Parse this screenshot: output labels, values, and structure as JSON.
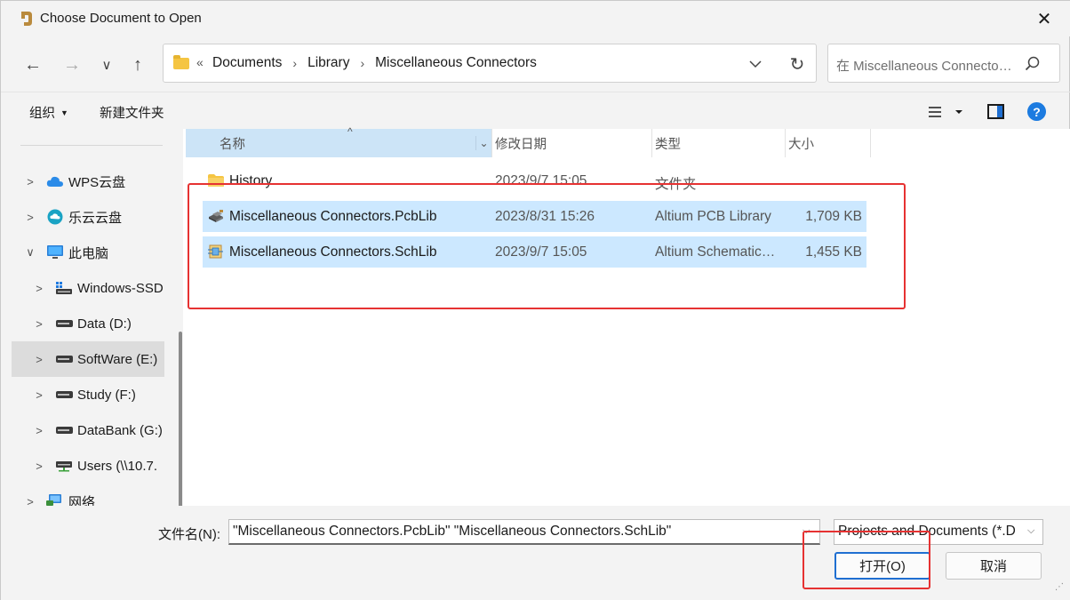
{
  "window": {
    "title": "Choose Document to Open",
    "close_glyph": "✕"
  },
  "nav": {
    "back_glyph": "←",
    "forward_glyph": "→",
    "recent_glyph": "∨",
    "up_glyph": "↑",
    "refresh_glyph": "↻",
    "overflow_glyph": "«",
    "breadcrumbs": [
      "Documents",
      "Library",
      "Miscellaneous Connectors"
    ],
    "search_placeholder": "在 Miscellaneous Connectors 中搜索"
  },
  "commandbar": {
    "organize_label": "组织",
    "new_folder_label": "新建文件夹"
  },
  "sidebar": {
    "items": [
      {
        "label": "WPS云盘",
        "icon": "cloud-icon",
        "chevron": ">"
      },
      {
        "label": "乐云云盘",
        "icon": "cloud-sync-icon",
        "chevron": ">"
      },
      {
        "label": "此电脑",
        "icon": "computer-icon",
        "chevron": "∨"
      },
      {
        "label": "Windows-SSD",
        "icon": "system-drive-icon",
        "chevron": ">"
      },
      {
        "label": "Data (D:)",
        "icon": "drive-icon",
        "chevron": ">"
      },
      {
        "label": "SoftWare (E:)",
        "icon": "drive-icon",
        "chevron": ">"
      },
      {
        "label": "Study (F:)",
        "icon": "drive-icon",
        "chevron": ">"
      },
      {
        "label": "DataBank (G:)",
        "icon": "drive-icon",
        "chevron": ">"
      },
      {
        "label": "Users (\\\\10.7.",
        "icon": "network-drive-icon",
        "chevron": ">"
      },
      {
        "label": "网络",
        "icon": "network-icon",
        "chevron": ">"
      }
    ],
    "selected_index": 5
  },
  "files": {
    "columns": {
      "name": "名称",
      "date": "修改日期",
      "type": "类型",
      "size": "大小"
    },
    "rows": [
      {
        "name": "History",
        "date": "2023/9/7 15:05",
        "type": "文件夹",
        "size": "",
        "icon": "folder-icon",
        "selected": false
      },
      {
        "name": "Miscellaneous Connectors.PcbLib",
        "date": "2023/8/31 15:26",
        "type": "Altium PCB Library",
        "size": "1,709 KB",
        "icon": "pcb-library-icon",
        "selected": true
      },
      {
        "name": "Miscellaneous Connectors.SchLib",
        "date": "2023/9/7 15:05",
        "type": "Altium Schematic Library",
        "size": "1,455 KB",
        "icon": "schematic-library-icon",
        "selected": true
      }
    ]
  },
  "footer": {
    "filename_label": "文件名(N):",
    "filename_value": "\"Miscellaneous Connectors.PcbLib\" \"Miscellaneous Connectors.SchLib\"",
    "filetype_value": "Projects and Documents (*.D",
    "open_label": "打开(O)",
    "cancel_label": "取消"
  },
  "colors": {
    "selection": "#cce8ff",
    "header_highlight": "#cce4f7",
    "annotation": "#e63232",
    "accent": "#1f6fd1"
  }
}
